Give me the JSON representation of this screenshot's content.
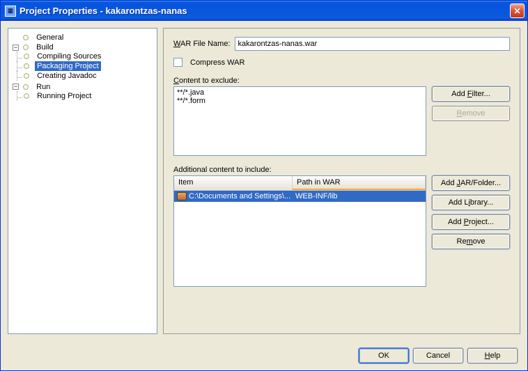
{
  "window": {
    "title": "Project Properties - kakarontzas-nanas"
  },
  "tree": {
    "general": "General",
    "build": "Build",
    "compiling": "Compiling Sources",
    "packaging": "Packaging Project",
    "javadoc": "Creating Javadoc",
    "run": "Run",
    "running": "Running Project"
  },
  "form": {
    "war_label": "WAR File Name:",
    "war_value": "kakarontzas-nanas.war",
    "compress_label": "Compress WAR",
    "exclude_label": "Content to exclude:",
    "exclude_items": [
      "**/*.java",
      "**/*.form"
    ],
    "include_label": "Additional content to include:",
    "col_item": "Item",
    "col_path": "Path in WAR",
    "rows": [
      {
        "item": "C:\\Documents and Settings\\...",
        "path": "WEB-INF/lib"
      }
    ]
  },
  "buttons": {
    "add_filter": "Add Filter...",
    "remove_filter": "Remove",
    "add_jar": "Add JAR/Folder...",
    "add_lib": "Add Library...",
    "add_proj": "Add Project...",
    "remove_inc": "Remove",
    "ok": "OK",
    "cancel": "Cancel",
    "help": "Help"
  }
}
